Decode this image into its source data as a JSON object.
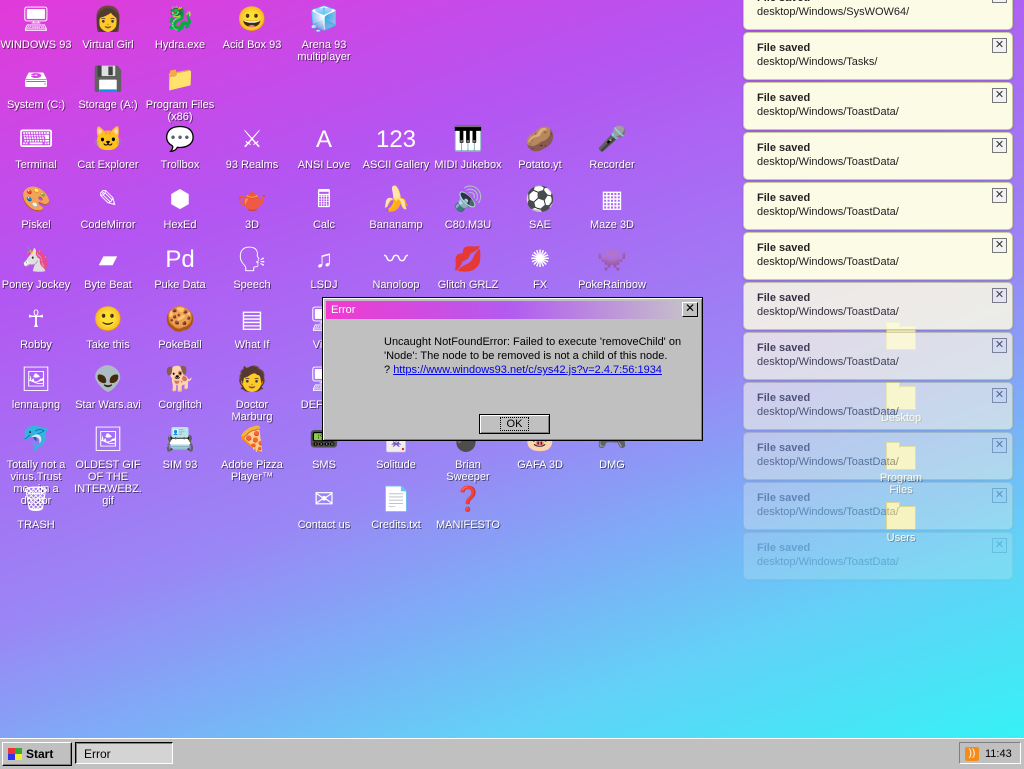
{
  "desktop_icons": [
    {
      "label": "WINDOWS 93",
      "glyph": "🖥"
    },
    {
      "label": "Virtual Girl",
      "glyph": "👩"
    },
    {
      "label": "Hydra.exe",
      "glyph": "🐉"
    },
    {
      "label": "Acid Box 93",
      "glyph": "😀"
    },
    {
      "label": "Arena 93 multiplayer",
      "glyph": "🧊"
    },
    {
      "label": "System (C:)",
      "glyph": "🖴"
    },
    {
      "label": "Storage (A:)",
      "glyph": "💾"
    },
    {
      "label": "Program Files (x86)",
      "glyph": "📁"
    },
    {
      "label": "Terminal",
      "glyph": "⌨"
    },
    {
      "label": "Cat Explorer",
      "glyph": "🐱"
    },
    {
      "label": "Trollbox",
      "glyph": "💬"
    },
    {
      "label": "93 Realms",
      "glyph": "⚔"
    },
    {
      "label": "ANSI Love",
      "glyph": "A"
    },
    {
      "label": "ASCII Gallery",
      "glyph": "123"
    },
    {
      "label": "MIDI Jukebox",
      "glyph": "🎹"
    },
    {
      "label": "Potato.yt",
      "glyph": "🥔"
    },
    {
      "label": "Recorder",
      "glyph": "🎤"
    },
    {
      "label": "Piskel",
      "glyph": "🎨"
    },
    {
      "label": "CodeMirror",
      "glyph": "✎"
    },
    {
      "label": "HexEd",
      "glyph": "⬢"
    },
    {
      "label": "3D",
      "glyph": "🫖"
    },
    {
      "label": "Calc",
      "glyph": "🖩"
    },
    {
      "label": "Bananamp",
      "glyph": "🍌"
    },
    {
      "label": "C80.M3U",
      "glyph": "🔊"
    },
    {
      "label": "SAE",
      "glyph": "⚽"
    },
    {
      "label": "Maze 3D",
      "glyph": "▦"
    },
    {
      "label": "Poney Jockey",
      "glyph": "🦄"
    },
    {
      "label": "Byte Beat",
      "glyph": "▰"
    },
    {
      "label": "Puke Data",
      "glyph": "Pd"
    },
    {
      "label": "Speech",
      "glyph": "🗣"
    },
    {
      "label": "LSDJ",
      "glyph": "♫"
    },
    {
      "label": "Nanoloop",
      "glyph": "〰"
    },
    {
      "label": "Glitch GRLZ",
      "glyph": "💋"
    },
    {
      "label": "FX",
      "glyph": "✺"
    },
    {
      "label": "PokeRainbow",
      "glyph": "👾"
    },
    {
      "label": "Robby",
      "glyph": "☥"
    },
    {
      "label": "Take this",
      "glyph": "🙂"
    },
    {
      "label": "PokeBall",
      "glyph": "🍪"
    },
    {
      "label": "What If",
      "glyph": "▤"
    },
    {
      "label": "Virtu",
      "glyph": "🖥"
    },
    {
      "label": "lenna.png",
      "glyph": "🖼"
    },
    {
      "label": "Star Wars.avi",
      "glyph": "👽"
    },
    {
      "label": "Corglitch",
      "glyph": "🐕"
    },
    {
      "label": "Doctor Marburg",
      "glyph": "🧑"
    },
    {
      "label": "DEFCON",
      "glyph": "🖥"
    },
    {
      "label": "Totally not a virus.Trust me...im a doctor",
      "glyph": "🐬"
    },
    {
      "label": "OLDEST GIF OF THE INTERWEBZ.gif",
      "glyph": "🖼"
    },
    {
      "label": "SIM 93",
      "glyph": "📇"
    },
    {
      "label": "Adobe Pizza Player™",
      "glyph": "🍕"
    },
    {
      "label": "SMS",
      "glyph": "📟"
    },
    {
      "label": "Solitude",
      "glyph": "🃏"
    },
    {
      "label": "Brian Sweeper",
      "glyph": "💣"
    },
    {
      "label": "GAFA 3D",
      "glyph": "🐷"
    },
    {
      "label": "DMG",
      "glyph": "🎮"
    },
    {
      "label": "TRASH",
      "glyph": "🗑"
    },
    {
      "label": "Contact us",
      "glyph": "✉"
    },
    {
      "label": "Credits.txt",
      "glyph": "📄"
    },
    {
      "label": "MANIFESTO",
      "glyph": "❓"
    }
  ],
  "toasts": [
    {
      "title": "File saved",
      "path": "desktop/Windows/SysWOW64/",
      "close": "✕"
    },
    {
      "title": "File saved",
      "path": "desktop/Windows/Tasks/",
      "close": "✕"
    },
    {
      "title": "File saved",
      "path": "desktop/Windows/ToastData/",
      "close": "✕"
    },
    {
      "title": "File saved",
      "path": "desktop/Windows/ToastData/",
      "close": "✕"
    },
    {
      "title": "File saved",
      "path": "desktop/Windows/ToastData/",
      "close": "✕"
    },
    {
      "title": "File saved",
      "path": "desktop/Windows/ToastData/",
      "close": "✕"
    },
    {
      "title": "File saved",
      "path": "desktop/Windows/ToastData/",
      "close": "✕"
    },
    {
      "title": "File saved",
      "path": "desktop/Windows/ToastData/",
      "close": "✕"
    },
    {
      "title": "File saved",
      "path": "desktop/Windows/ToastData/",
      "close": "✕"
    },
    {
      "title": "File saved",
      "path": "desktop/Windows/ToastData/",
      "close": "✕"
    },
    {
      "title": "File saved",
      "path": "desktop/Windows/ToastData/",
      "close": "✕"
    },
    {
      "title": "File saved",
      "path": "desktop/Windows/ToastData/",
      "close": "✕"
    }
  ],
  "right_folders": [
    {
      "label": ""
    },
    {
      "label": "Desktop"
    },
    {
      "label": "Program Files"
    },
    {
      "label": "Users"
    }
  ],
  "dialog": {
    "title": "Error",
    "close": "✕",
    "message": "Uncaught NotFoundError: Failed to execute 'removeChild' on 'Node': The node to be removed is not a child of this node.",
    "link_prefix": "? ",
    "link": "https://www.windows93.net/c/sys42.js?v=2.4.7:56:1934",
    "ok": "OK"
  },
  "taskbar": {
    "start": "Start",
    "task": "Error",
    "clock": "11:43",
    "rss": "rss"
  }
}
